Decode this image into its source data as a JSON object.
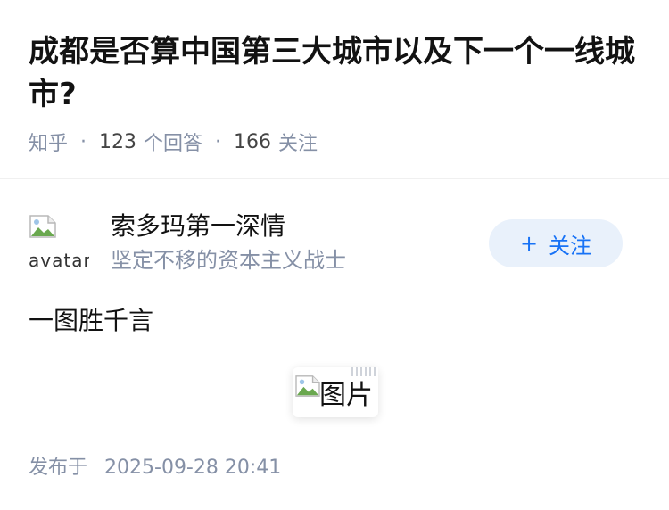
{
  "question": {
    "title": "成都是否算中国第三大城市以及下一个一线城市?",
    "source": "知乎",
    "answer_count": "123",
    "answer_label": "个回答",
    "follower_count": "166",
    "follower_label": "关注"
  },
  "author": {
    "avatar_alt": "avatar",
    "name": "索多玛第一深情",
    "bio": "坚定不移的资本主义战士",
    "follow_label": "关注",
    "follow_icon": "plus-icon"
  },
  "answer": {
    "text": "一图胜千言",
    "image_alt": "图片"
  },
  "footer": {
    "publish_label": "发布于",
    "publish_time": "2025-09-28 20:41"
  },
  "colors": {
    "accent": "#1772f6",
    "follow_bg": "#e9f1fb",
    "meta": "#8590a6",
    "title": "#121212"
  }
}
